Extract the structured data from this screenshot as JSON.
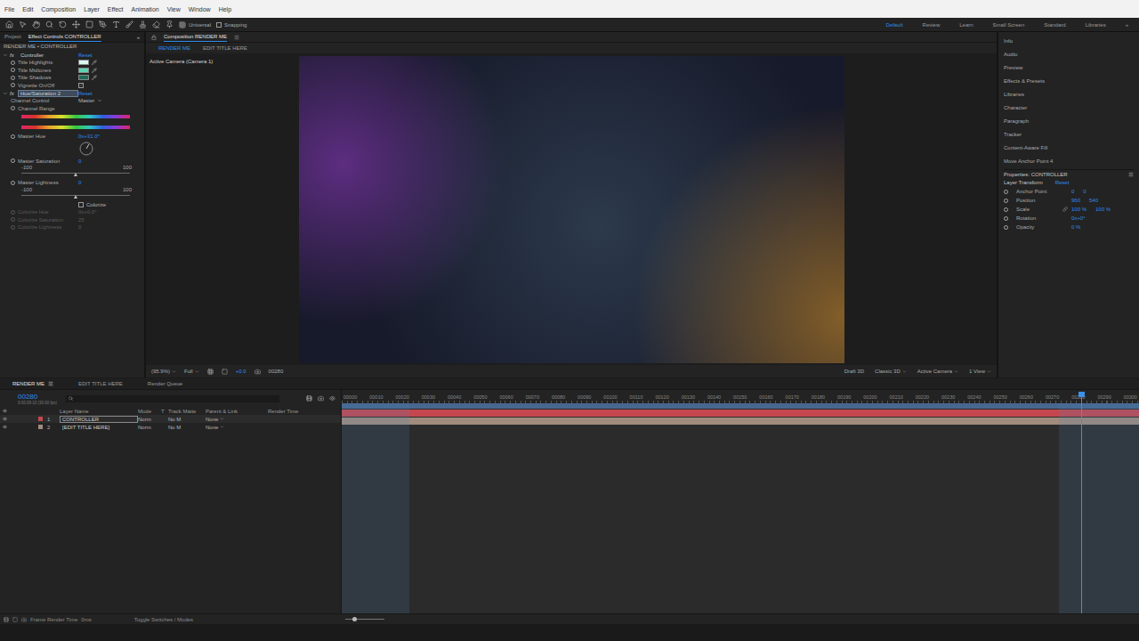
{
  "menu": [
    "File",
    "Edit",
    "Composition",
    "Layer",
    "Effect",
    "Animation",
    "View",
    "Window",
    "Help"
  ],
  "toolbar": {
    "axis_mode": "Universal",
    "snapping": {
      "label": "Snapping",
      "checked": false
    },
    "workspaces": [
      {
        "label": "Default",
        "selected": true
      },
      {
        "label": "Review",
        "selected": false
      },
      {
        "label": "Learn",
        "selected": false
      },
      {
        "label": "Small Screen",
        "selected": false
      },
      {
        "label": "Standard",
        "selected": false
      },
      {
        "label": "Libraries",
        "selected": false
      }
    ],
    "more": "»"
  },
  "left_panel": {
    "tabs": [
      {
        "label": "Project",
        "selected": false
      },
      {
        "label": "Effect Controls CONTROLLER",
        "selected": true
      }
    ],
    "more": "»",
    "header": "RENDER ME • CONTROLLER",
    "effects": [
      {
        "badge": "fx",
        "name": "Controller",
        "reset": "Reset",
        "expanded": true,
        "selected": false,
        "rows": [
          {
            "kind": "swatch",
            "label": "Title Highlights",
            "color": "#d9f7ef"
          },
          {
            "kind": "swatch",
            "label": "Title Midtones",
            "color": "#5cd3b4"
          },
          {
            "kind": "swatch",
            "label": "Title Shadows",
            "color": "#1d6a57"
          },
          {
            "kind": "checkbox",
            "label": "Vignette On/Off",
            "checked": true
          }
        ]
      },
      {
        "badge": "fx",
        "name": "Hue/Saturation 2",
        "reset": "Reset",
        "expanded": true,
        "selected": true,
        "rows": [
          {
            "kind": "dropdown",
            "label": "Channel Control",
            "value": "Master"
          },
          {
            "kind": "range",
            "label": "Channel Range"
          },
          {
            "kind": "dial",
            "label": "Master Hue",
            "value": "0x+31.0°",
            "level": 0.086
          },
          {
            "kind": "slider",
            "label": "Master Saturation",
            "value": "0",
            "min": "-100",
            "max": "100",
            "level": 0.5
          },
          {
            "kind": "slider",
            "label": "Master Lightness",
            "value": "0",
            "min": "-100",
            "max": "100",
            "level": 0.5
          },
          {
            "kind": "toggle",
            "label": "Colorize",
            "checked": false
          },
          {
            "kind": "value",
            "label": "Colorize Hue",
            "value": "0x+0.0°",
            "disabled": true
          },
          {
            "kind": "value",
            "label": "Colorize Saturation",
            "value": "25",
            "disabled": true
          },
          {
            "kind": "value",
            "label": "Colorize Lightness",
            "value": "0",
            "disabled": true
          }
        ]
      }
    ]
  },
  "viewer": {
    "tabs": [
      {
        "label": "Composition RENDER ME",
        "selected": true
      }
    ],
    "subtabs": [
      {
        "label": "RENDER ME",
        "selected": true
      },
      {
        "label": "EDIT TITLE HERE",
        "selected": false
      }
    ],
    "camera_label": "Active Camera (Camera 1)",
    "bar": {
      "zoom": "(95.9%)",
      "resolution": "Full",
      "exposure": "+0.0",
      "time": "00280",
      "draft": "Draft 3D",
      "renderer": "Classic 3D",
      "view": "Active Camera",
      "layout": "1 View"
    }
  },
  "right_panel": {
    "panels": [
      "Info",
      "Audio",
      "Preview",
      "Effects & Presets",
      "Libraries",
      "Character",
      "Paragraph",
      "Tracker",
      "Content-Aware Fill",
      "Move Anchor Point 4"
    ],
    "properties": {
      "title": "Properties: CONTROLLER",
      "section": "Layer Transform",
      "reset": "Reset",
      "rows": [
        {
          "label": "Anchor Point",
          "values": [
            "0",
            "0"
          ],
          "linked": false
        },
        {
          "label": "Position",
          "values": [
            "960",
            "540"
          ],
          "linked": false
        },
        {
          "label": "Scale",
          "values": [
            "100 %",
            "100 %"
          ],
          "linked": true
        },
        {
          "label": "Rotation",
          "values": [
            "0x+0°"
          ],
          "linked": false
        },
        {
          "label": "Opacity",
          "values": [
            "0 %"
          ],
          "linked": false
        }
      ]
    }
  },
  "timeline": {
    "tabs": [
      {
        "label": "RENDER ME",
        "selected": true
      },
      {
        "label": "EDIT TITLE HERE",
        "selected": false
      },
      {
        "label": "Render Queue",
        "selected": false
      }
    ],
    "time": "00280",
    "time_sub": "0:00:09:10 (30.00 fps)",
    "columns": [
      "Layer Name",
      "Mode",
      "T",
      "Track Matte",
      "Parent & Link",
      "Render Time"
    ],
    "layers": [
      {
        "num": "1",
        "name": "CONTROLLER",
        "mode": "Norm",
        "matte": "No M",
        "parent": "None",
        "selected": true,
        "visible": true,
        "color": "#c4474f"
      },
      {
        "num": "2",
        "name": "[EDIT TITLE HERE]",
        "mode": "Norm",
        "matte": "No M",
        "parent": "None",
        "selected": false,
        "visible": true,
        "color": "#a08b7c"
      }
    ],
    "ruler": [
      "00000",
      "00010",
      "00020",
      "00030",
      "00040",
      "00050",
      "00060",
      "00070",
      "00080",
      "00090",
      "00100",
      "00110",
      "00120",
      "00130",
      "00140",
      "00150",
      "00160",
      "00170",
      "00180",
      "00190",
      "00200",
      "00210",
      "00220",
      "00230",
      "00240",
      "00250",
      "00260",
      "00270",
      "00280",
      "00290",
      "00300"
    ],
    "playhead": {
      "level": 0.928
    },
    "marked_ranges": [
      {
        "start": 0.0,
        "end": 0.085
      },
      {
        "start": 0.9,
        "end": 1.0
      }
    ],
    "footer": {
      "render_time_label": "Frame Render Time",
      "render_time": "0ms",
      "toggle": "Toggle Switches / Modes"
    }
  }
}
